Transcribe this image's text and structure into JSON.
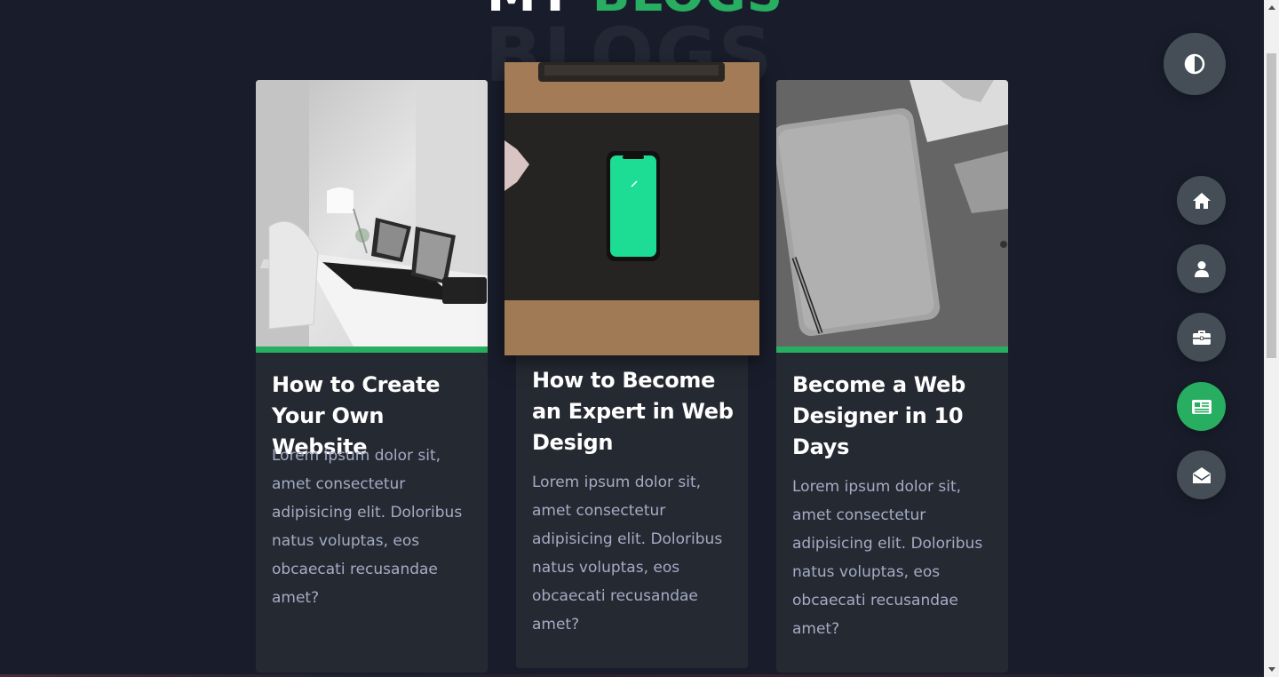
{
  "heading": {
    "word1": "MY",
    "word2": "BLOGS",
    "watermark": "BLOGS"
  },
  "blogs": [
    {
      "title": "How to Create Your Own Website",
      "text": "Lorem ipsum dolor sit, amet consectetur adipisicing elit. Doloribus natus voluptas, eos obcaecati recusandae amet?"
    },
    {
      "title": "How to Become an Expert in Web Design",
      "text": "Lorem ipsum dolor sit, amet consectetur adipisicing elit. Doloribus natus voluptas, eos obcaecati recusandae amet?"
    },
    {
      "title": "Become a Web Designer in 10 Days",
      "text": "Lorem ipsum dolor sit, amet consectetur adipisicing elit. Doloribus natus voluptas, eos obcaecati recusandae amet?"
    }
  ],
  "controls": {
    "theme_icon": "contrast-icon",
    "nav": [
      {
        "icon": "home-icon",
        "active": false
      },
      {
        "icon": "user-icon",
        "active": false
      },
      {
        "icon": "briefcase-icon",
        "active": false
      },
      {
        "icon": "newspaper-icon",
        "active": true
      },
      {
        "icon": "envelope-open-icon",
        "active": false
      }
    ]
  },
  "colors": {
    "background": "#191d2b",
    "card": "#252932",
    "accent": "#27ae60",
    "control": "#454e56",
    "text_muted": "#a4acc4"
  }
}
